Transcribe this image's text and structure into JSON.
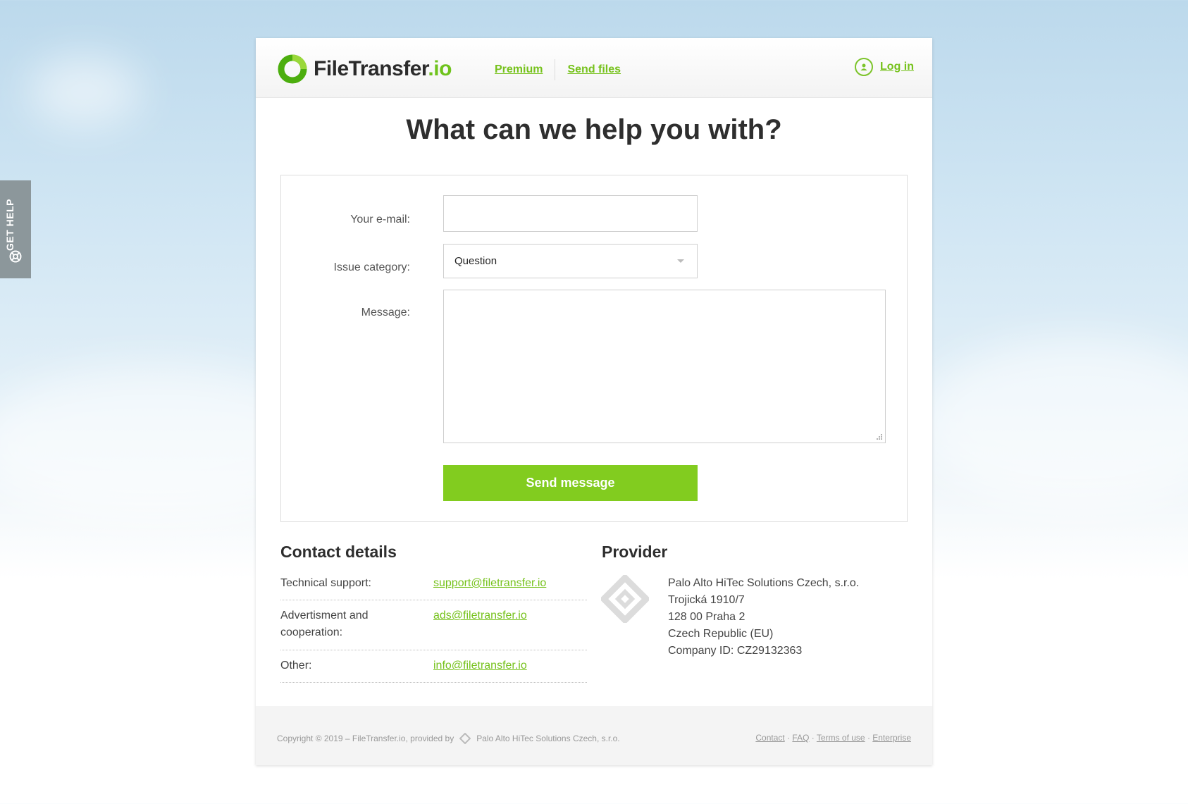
{
  "get_help": {
    "label": "GET HELP"
  },
  "header": {
    "logo_text": "FileTransfer",
    "logo_suffix": ".io",
    "nav": [
      {
        "label": "Premium"
      },
      {
        "label": "Send files"
      }
    ],
    "login_label": "Log in"
  },
  "title": "What can we help you with?",
  "form": {
    "email_label": "Your e-mail:",
    "email_value": "",
    "category_label": "Issue category:",
    "category_value": "Question",
    "message_label": "Message:",
    "message_value": "",
    "submit_label": "Send message"
  },
  "contact": {
    "title": "Contact details",
    "rows": [
      {
        "key": "Technical support:",
        "value": "support@filetransfer.io"
      },
      {
        "key": "Advertisment and cooperation:",
        "value": "ads@filetransfer.io"
      },
      {
        "key": "Other:",
        "value": "info@filetransfer.io"
      }
    ]
  },
  "provider": {
    "title": "Provider",
    "lines": [
      "Palo Alto HiTec Solutions Czech, s.r.o.",
      "Trojická 1910/7",
      "128 00 Praha 2",
      "Czech Republic (EU)",
      "Company ID: CZ29132363"
    ]
  },
  "footer": {
    "copyright": "Copyright © 2019 – FileTransfer.io, provided by",
    "provider_name": "Palo Alto HiTec Solutions Czech, s.r.o.",
    "links": [
      "Contact",
      "FAQ",
      "Terms of use",
      "Enterprise"
    ],
    "link_separator": "·"
  },
  "colors": {
    "accent": "#82cc1f",
    "link": "#76c21c",
    "get_help_bg": "#8c979b"
  },
  "icons": [
    "lifebuoy-icon",
    "logo-ring-icon",
    "user-icon",
    "provider-diamond-icon",
    "chevron-down-icon",
    "resize-grip-icon"
  ]
}
